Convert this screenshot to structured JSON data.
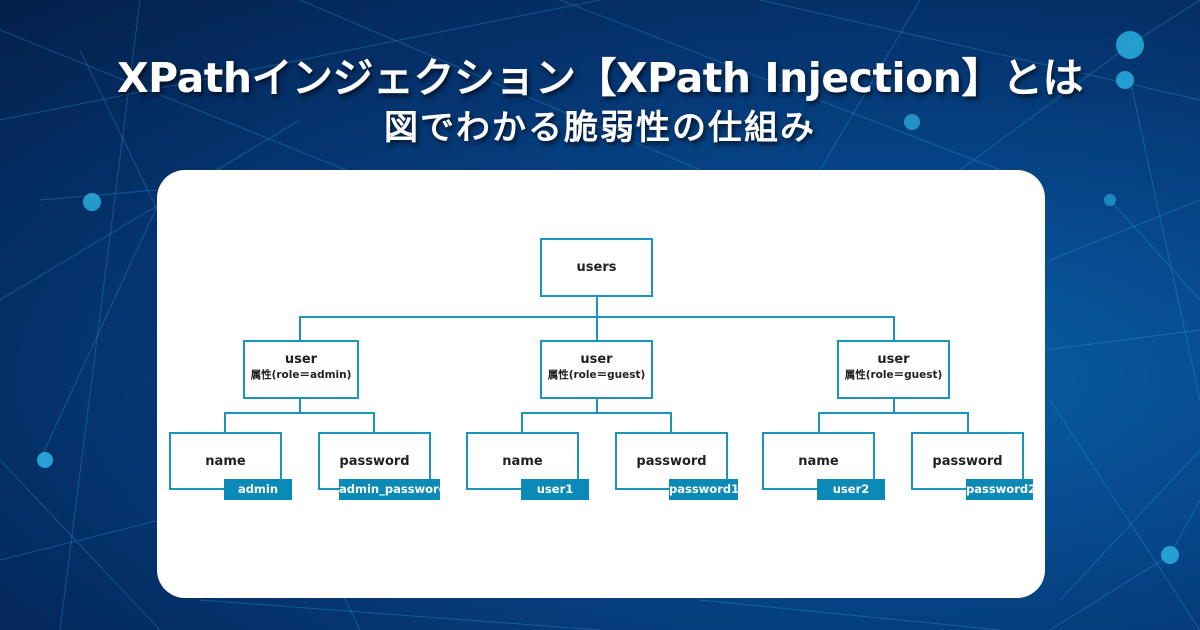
{
  "title": {
    "line1": "XPathインジェクション【XPath Injection】とは",
    "line2": "図でわかる脆弱性の仕組み"
  },
  "colors": {
    "accent": "#1a93bf",
    "value_fill": "#0b8ab8",
    "background": "#053672"
  },
  "diagram": {
    "root": {
      "label": "users"
    },
    "users": [
      {
        "label": "user",
        "attr": "属性(role＝admin)",
        "name": {
          "label": "name",
          "value": "admin"
        },
        "password": {
          "label": "password",
          "value": "admin_password"
        }
      },
      {
        "label": "user",
        "attr": "属性(role＝guest)",
        "name": {
          "label": "name",
          "value": "user1"
        },
        "password": {
          "label": "password",
          "value": "password1"
        }
      },
      {
        "label": "user",
        "attr": "属性(role＝guest)",
        "name": {
          "label": "name",
          "value": "user2"
        },
        "password": {
          "label": "password",
          "value": "password2"
        }
      }
    ]
  }
}
